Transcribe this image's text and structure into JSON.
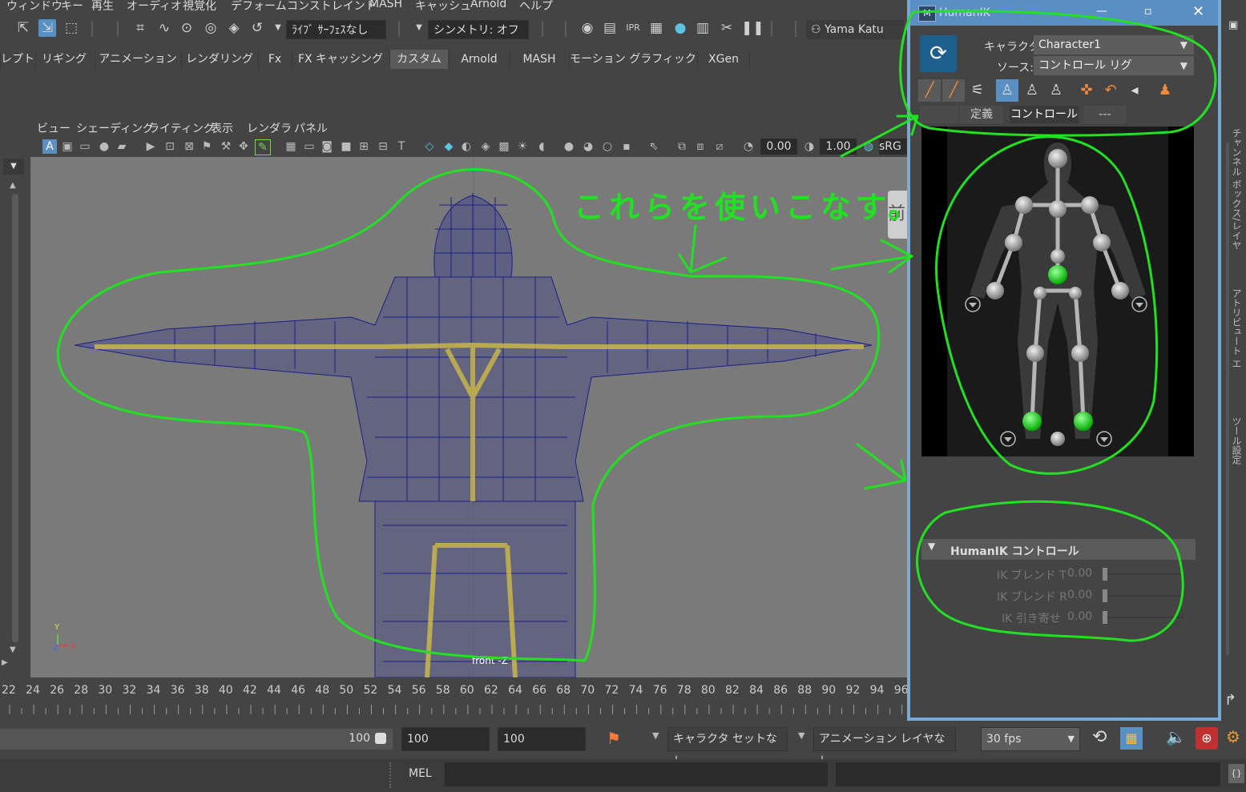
{
  "menubar": {
    "items": [
      "ウィンドウ",
      "キー",
      "再生",
      "オーディオ",
      "視覚化",
      "デフォーム",
      "コンストレイント",
      "MASH",
      "キャッシュ",
      "Arnold",
      "ヘルプ"
    ]
  },
  "toolbar": {
    "live_surface": "ﾗｲﾌﾞ ｻｰﾌｪｽなし",
    "symmetry": "シンメトリ: オフ",
    "user": "Yama Katu"
  },
  "shelf": {
    "tabs": [
      "レプト",
      "リギング",
      "アニメーション",
      "レンダリング",
      "Fx",
      "FX キャッシング",
      "カスタム",
      "Arnold",
      "MASH",
      "モーション グラフィックス",
      "XGen"
    ],
    "active": "カスタム"
  },
  "panel": {
    "menu": [
      "ビュー",
      "シェーディング",
      "ライティング",
      "表示",
      "レンダラ",
      "パネル"
    ],
    "toolbar": {
      "value_a": "0.00",
      "value_b": "1.00",
      "color_space": "sRG"
    },
    "camera_label": "front -Z",
    "axes": {
      "y": "Y",
      "x": "X",
      "z": "Z"
    }
  },
  "annotation": {
    "text": "これらを使いこなす。",
    "color": "#22e022"
  },
  "timeline": {
    "ticks": [
      "22",
      "24",
      "26",
      "28",
      "30",
      "32",
      "34",
      "36",
      "38",
      "40",
      "42",
      "44",
      "46",
      "48",
      "50",
      "52",
      "54",
      "56",
      "58",
      "60",
      "62",
      "64",
      "66",
      "68",
      "70",
      "72",
      "74",
      "76",
      "78",
      "80",
      "82",
      "84",
      "86",
      "88",
      "90",
      "92",
      "94",
      "96"
    ]
  },
  "range": {
    "slider_end": "100",
    "end_a": "100",
    "end_b": "100",
    "character_set": "キャラクタ セットなし",
    "anim_layer": "アニメーション レイヤなし",
    "fps": "30 fps"
  },
  "command": {
    "mode": "MEL"
  },
  "humanik": {
    "title": "HumanIK",
    "character_label": "キャラクタ:",
    "character_value": "Character1",
    "source_label": "ソース:",
    "source_value": "コントロール リグ",
    "tabs": [
      "定義",
      "コントロール",
      "---"
    ],
    "active_tab": "コントロール",
    "controls_header": "HumanIK コントロール",
    "sliders": [
      {
        "label": "IK ブレンド T",
        "value": "0.00"
      },
      {
        "label": "IK ブレンド R",
        "value": "0.00"
      },
      {
        "label": "IK 引き寄せ",
        "value": "0.00"
      }
    ]
  },
  "right_edge": {
    "tab_a": "アトリビュート エディタ",
    "tab_b": "ツール設定",
    "tab_c": "チャンネル ボックス/レイヤ エディタ"
  }
}
